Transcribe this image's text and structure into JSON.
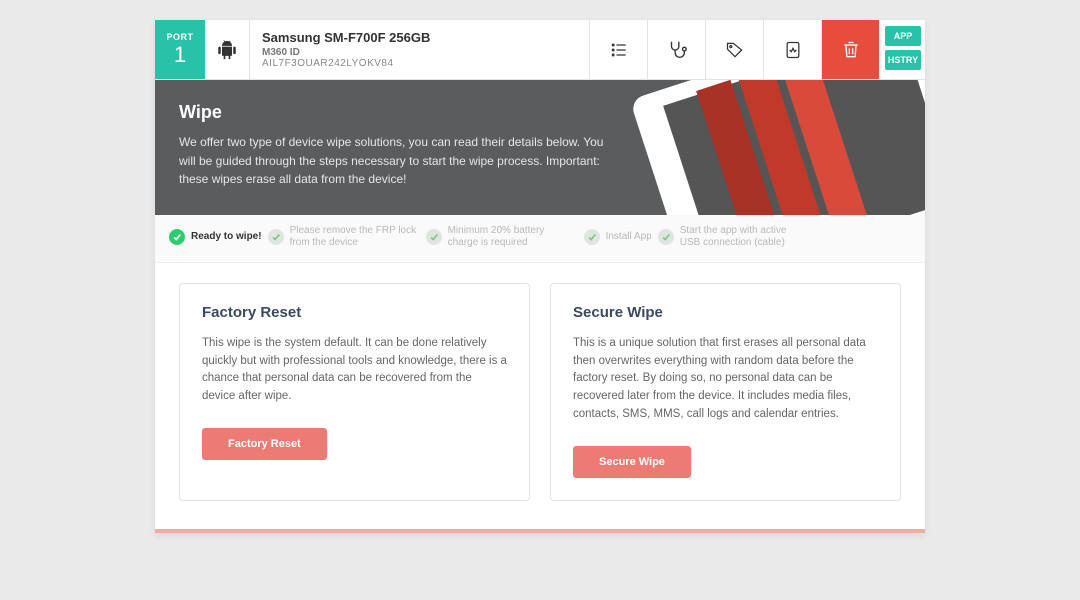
{
  "port": {
    "label": "PORT",
    "number": "1"
  },
  "device": {
    "model": "Samsung SM-F700F 256GB",
    "id_label": "M360 ID",
    "id": "AIL7F3OUAR242LYOKV84"
  },
  "side": {
    "app": "APP",
    "history": "HSTRY"
  },
  "hero": {
    "title": "Wipe",
    "body": "We offer two type of device wipe solutions, you can read their details below. You will be guided through the steps necessary to start the wipe process. Important: these wipes erase all data from the device!"
  },
  "status": {
    "ready": "Ready to wipe!",
    "frp": "Please remove the FRP lock from the device",
    "battery": "Minimum 20% battery charge is required",
    "install": "Install App",
    "usb": "Start the app with active USB connection (cable)"
  },
  "cards": {
    "factory": {
      "title": "Factory Reset",
      "body": "This wipe is the system default. It can be done relatively quickly but with professional tools and knowledge, there is a chance that personal data can be recovered from the device after wipe.",
      "button": "Factory Reset"
    },
    "secure": {
      "title": "Secure Wipe",
      "body": "This is a unique solution that first erases all personal data then overwrites everything with random data before the factory reset. By doing so, no personal data can be recovered later from the device. It includes media files, contacts, SMS, MMS, call logs and calendar entries.",
      "button": "Secure Wipe"
    }
  }
}
